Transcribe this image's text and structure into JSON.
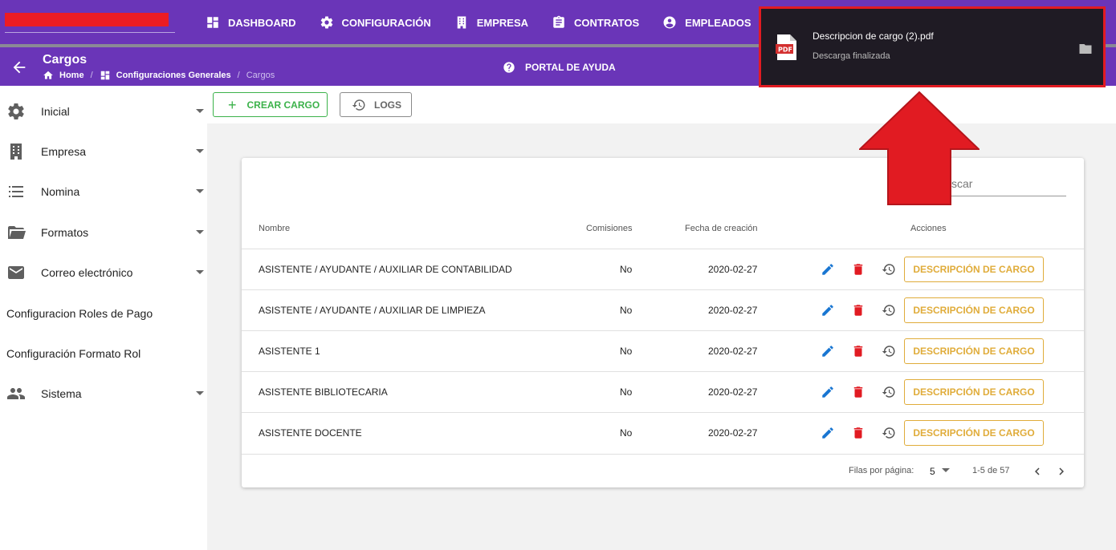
{
  "topnav": {
    "items": [
      {
        "label": "DASHBOARD",
        "icon": "dashboard-icon"
      },
      {
        "label": "CONFIGURACIÓN",
        "icon": "gear-icon"
      },
      {
        "label": "EMPRESA",
        "icon": "building-icon"
      },
      {
        "label": "CONTRATOS",
        "icon": "clipboard-icon"
      },
      {
        "label": "EMPLEADOS",
        "icon": "person-icon"
      },
      {
        "label": "",
        "icon": "group-icon"
      }
    ]
  },
  "header": {
    "title": "Cargos",
    "breadcrumb": [
      "Home",
      "Configuraciones Generales",
      "Cargos"
    ],
    "help_label": "PORTAL DE AYUDA"
  },
  "sidebar": {
    "items": [
      {
        "label": "Inicial",
        "icon": "gear-icon"
      },
      {
        "label": "Empresa",
        "icon": "building-icon"
      },
      {
        "label": "Nomina",
        "icon": "list-icon"
      },
      {
        "label": "Formatos",
        "icon": "folder-open-icon"
      },
      {
        "label": "Correo electrónico",
        "icon": "mail-icon"
      },
      {
        "label": "Configuracion Roles de Pago"
      },
      {
        "label": "Configuración Formato Rol"
      },
      {
        "label": "Sistema",
        "icon": "group-icon"
      }
    ]
  },
  "toolbar": {
    "create_label": "CREAR CARGO",
    "logs_label": "LOGS"
  },
  "table": {
    "search_text": "scar",
    "headers": [
      "Nombre",
      "Comisiones",
      "Fecha de creación",
      "Acciones"
    ],
    "rows": [
      {
        "nombre": "ASISTENTE / AYUDANTE / AUXILIAR DE CONTABILIDAD",
        "comisiones": "No",
        "fecha": "2020-02-27",
        "action_label": "DESCRIPCIÓN DE CARGO"
      },
      {
        "nombre": "ASISTENTE / AYUDANTE / AUXILIAR DE LIMPIEZA",
        "comisiones": "No",
        "fecha": "2020-02-27",
        "action_label": "DESCRIPCIÓN DE CARGO"
      },
      {
        "nombre": "ASISTENTE 1",
        "comisiones": "No",
        "fecha": "2020-02-27",
        "action_label": "DESCRIPCIÓN DE CARGO"
      },
      {
        "nombre": "ASISTENTE BIBLIOTECARIA",
        "comisiones": "No",
        "fecha": "2020-02-27",
        "action_label": "DESCRIPCIÓN DE CARGO"
      },
      {
        "nombre": "ASISTENTE DOCENTE",
        "comisiones": "No",
        "fecha": "2020-02-27",
        "action_label": "DESCRIPCIÓN DE CARGO"
      }
    ],
    "footer": {
      "rows_per_page_label": "Filas por página:",
      "rows_per_page_value": "5",
      "range": "1-5 de 57"
    }
  },
  "download": {
    "file_name": "Descripcion de cargo (2).pdf",
    "status": "Descarga finalizada",
    "file_badge": "PDF"
  },
  "colors": {
    "brand": "#6a35b8",
    "create": "#3bb24a",
    "description_button": "#e0ac3a",
    "edit": "#1976d2",
    "delete": "#e11b22",
    "annotation": "#e11b22"
  }
}
